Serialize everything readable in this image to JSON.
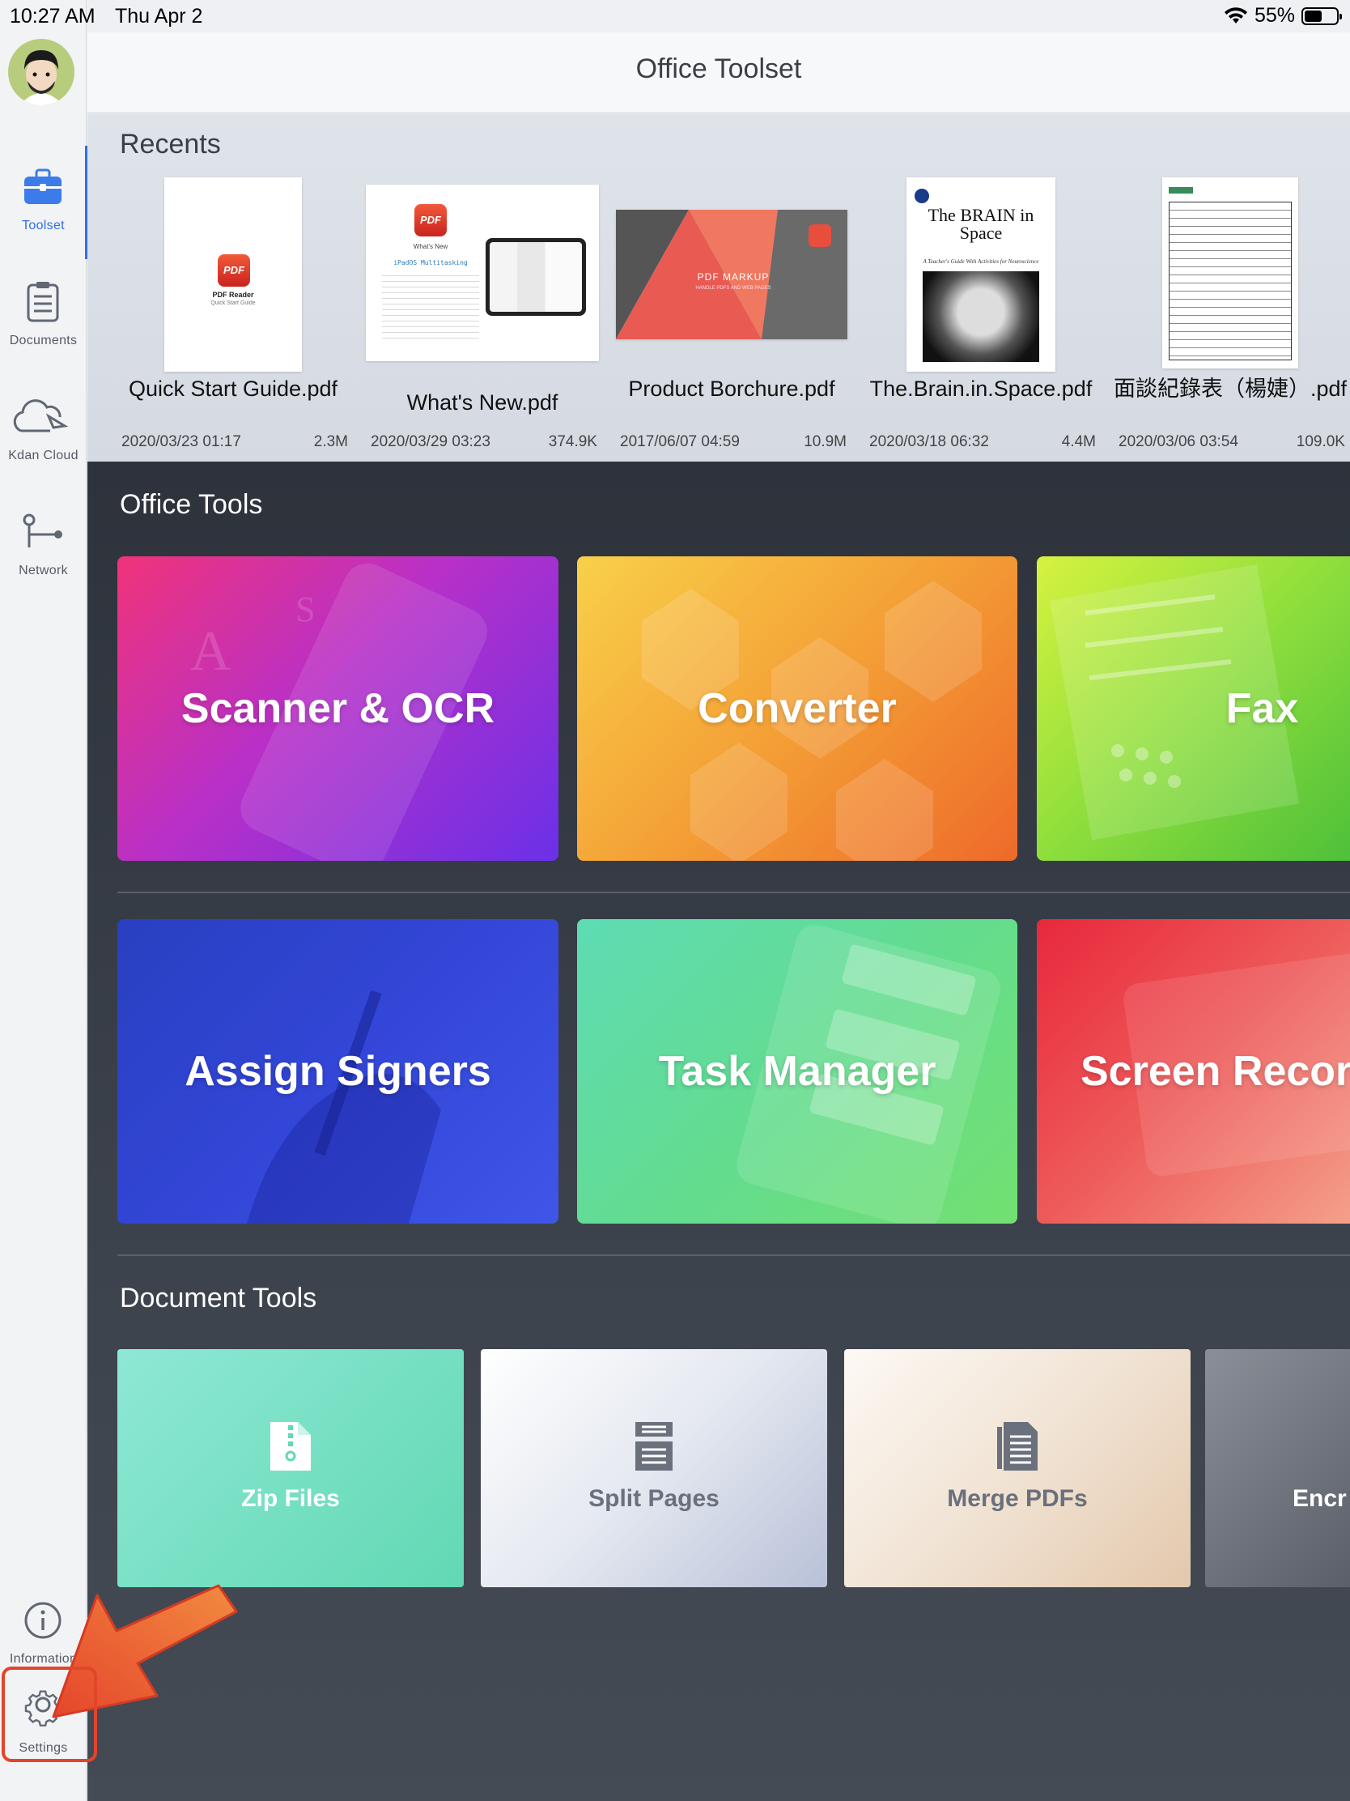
{
  "status_bar": {
    "time": "10:27 AM",
    "date": "Thu Apr 2",
    "battery_percent": "55%",
    "battery_level": 0.55
  },
  "sidebar": {
    "items": [
      {
        "label": "Toolset",
        "icon": "toolbox-icon",
        "active": true
      },
      {
        "label": "Documents",
        "icon": "clipboard-list-icon"
      },
      {
        "label": "Kdan Cloud",
        "icon": "cloud-icon"
      },
      {
        "label": "Network",
        "icon": "network-connection-icon"
      },
      {
        "label": "Information",
        "icon": "info-circle-icon"
      },
      {
        "label": "Settings",
        "icon": "gear-icon"
      }
    ]
  },
  "header": {
    "title": "Office Toolset"
  },
  "recents": {
    "title": "Recents",
    "items": [
      {
        "name": "Quick Start Guide.pdf",
        "date": "2020/03/23 01:17",
        "size": "2.3M",
        "thumb_title": "PDF Reader",
        "thumb_sub": "Quick Start Guide",
        "thumb_logo": "PDF"
      },
      {
        "name": "What's New.pdf",
        "date": "2020/03/29 03:23",
        "size": "374.9K",
        "thumb_title": "What's New",
        "thumb_sub": "iPadOS Multitasking",
        "thumb_logo": "PDF"
      },
      {
        "name": "Product Borchure.pdf",
        "date": "2017/06/07 04:59",
        "size": "10.9M",
        "thumb_title": "PDF MARKUP",
        "thumb_sub": "HANDLE PDFS AND WEB PAGES"
      },
      {
        "name": "The.Brain.in.Space.pdf",
        "date": "2020/03/18 06:32",
        "size": "4.4M",
        "thumb_title": "The BRAIN in Space",
        "thumb_sub": "A Teacher's Guide With Activities for Neuroscience"
      },
      {
        "name": "面談紀錄表（楊婕）.pdf",
        "date": "2020/03/06 03:54",
        "size": "109.0K"
      }
    ]
  },
  "office_tools": {
    "title": "Office Tools",
    "items": [
      {
        "label": "Scanner & OCR",
        "colors": [
          "#e8327a",
          "#7a2ee0"
        ]
      },
      {
        "label": "Converter",
        "colors": [
          "#f7c03a",
          "#f07a2a"
        ]
      },
      {
        "label": "Fax",
        "colors": [
          "#c6ee3a",
          "#58c83c"
        ]
      },
      {
        "label": "Assign Signers",
        "colors": [
          "#2d43c8",
          "#3c53e6"
        ]
      },
      {
        "label": "Task Manager",
        "colors": [
          "#55d8a8",
          "#6ee07a"
        ]
      },
      {
        "label": "Screen Record",
        "colors": [
          "#e8283e",
          "#f08a78"
        ]
      }
    ]
  },
  "document_tools": {
    "title": "Document Tools",
    "items": [
      {
        "label": "Zip Files",
        "icon": "zip-file-icon"
      },
      {
        "label": "Split Pages",
        "icon": "split-pages-icon"
      },
      {
        "label": "Merge PDFs",
        "icon": "merge-pdfs-icon"
      },
      {
        "label": "Encr",
        "icon": "lock-icon"
      }
    ]
  }
}
